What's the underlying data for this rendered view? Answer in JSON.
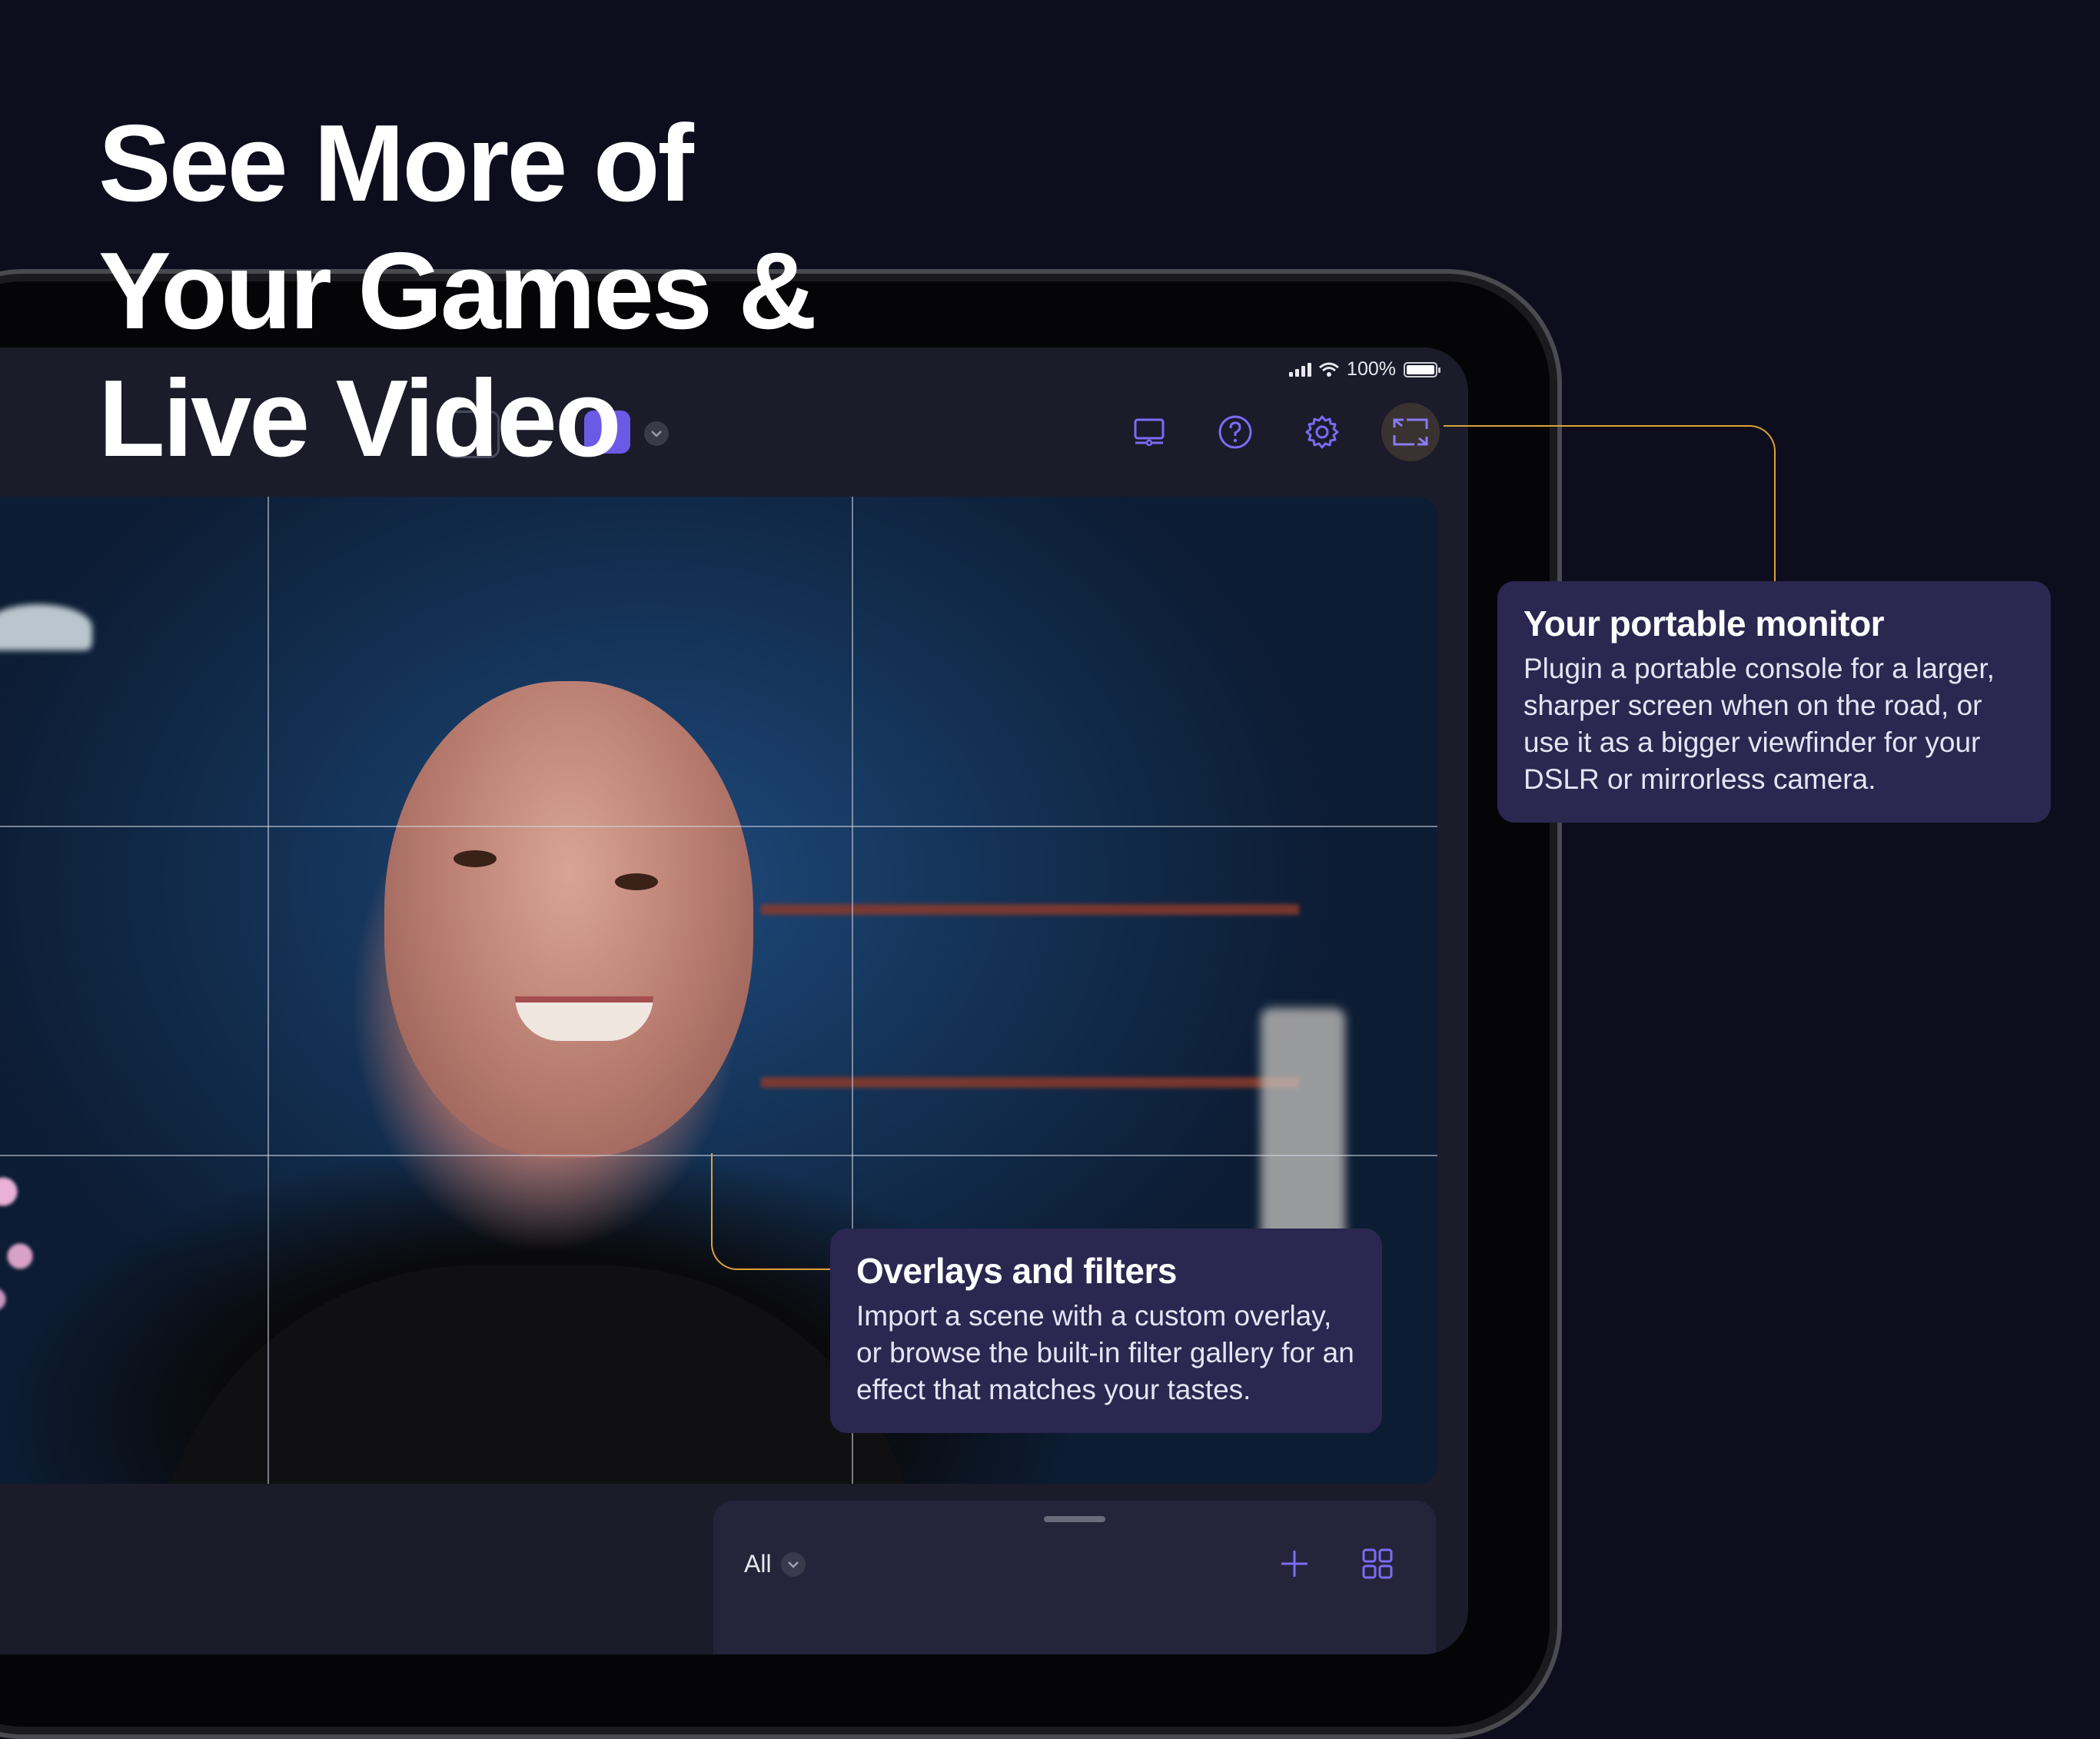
{
  "headline": {
    "line1": "See More of",
    "line2": "Your Games &",
    "line3": "Live Video"
  },
  "status_bar": {
    "battery_text": "100%"
  },
  "toolbar": {
    "icons": [
      "monitor-icon",
      "help-icon",
      "settings-gear-icon",
      "fullscreen-icon"
    ],
    "accent_color": "#7b6cf6"
  },
  "drawer": {
    "filter_label": "All"
  },
  "callouts": {
    "monitor": {
      "title": "Your portable monitor",
      "body": "Plugin a portable console for a larger, sharper screen when on the road, or use it as a bigger viewfinder for your DSLR or mirrorless camera."
    },
    "overlays": {
      "title": "Overlays and filters",
      "body": "Import a scene with a custom overlay, or browse the built-in filter gallery for an effect that matches your tastes."
    }
  },
  "colors": {
    "background": "#0e0d1d",
    "callout_bg": "#2b2750",
    "connector": "#d8a33a"
  }
}
